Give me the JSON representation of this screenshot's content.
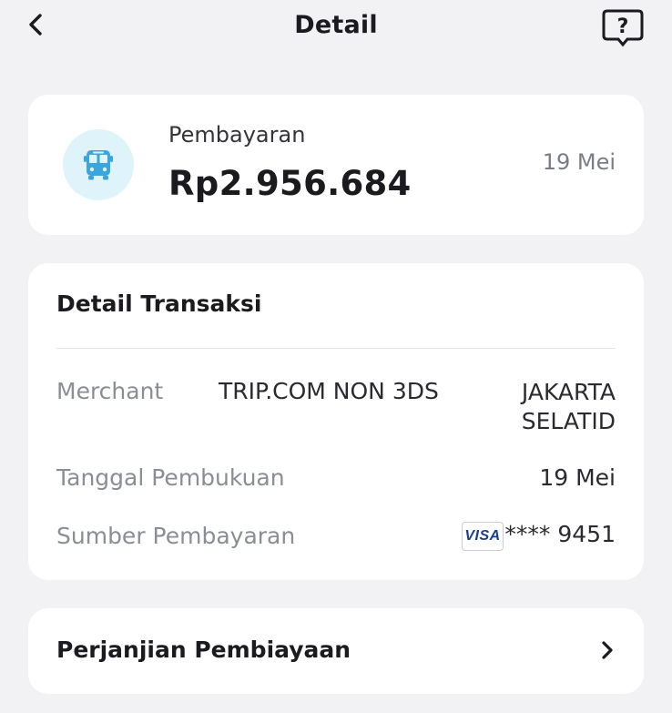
{
  "header": {
    "title": "Detail",
    "back_icon": "chevron-left-icon",
    "help_icon": "help-chat-icon",
    "help_glyph": "?"
  },
  "payment": {
    "icon": "bus-icon",
    "label": "Pembayaran",
    "amount": "Rp2.956.684",
    "date": "19 Mei",
    "icon_bg": "#dff3fb",
    "icon_color": "#3aa6dd"
  },
  "transaction_detail": {
    "title": "Detail Transaksi",
    "merchant": {
      "label": "Merchant",
      "name": "TRIP.COM NON 3DS",
      "city_line1": "JAKARTA",
      "city_line2": "SELATID"
    },
    "booking_date": {
      "label": "Tanggal Pembukuan",
      "value": "19 Mei"
    },
    "payment_source": {
      "label": "Sumber Pembayaran",
      "card_brand": "VISA",
      "card_number": "**** 9451"
    }
  },
  "agreement": {
    "label": "Perjanjian Pembiayaan",
    "icon": "chevron-right-icon"
  }
}
